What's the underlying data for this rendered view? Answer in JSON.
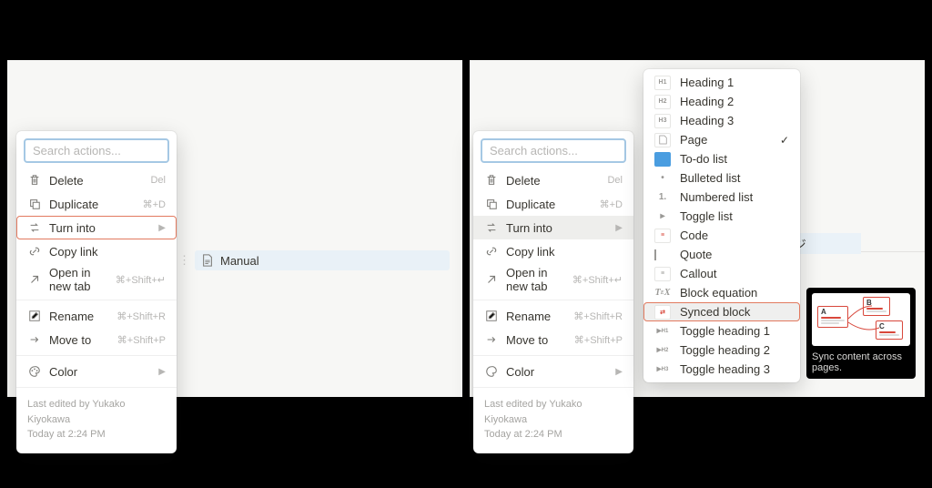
{
  "search_placeholder": "Search actions...",
  "menu": {
    "delete": {
      "label": "Delete",
      "shortcut": "Del"
    },
    "duplicate": {
      "label": "Duplicate",
      "shortcut": "⌘+D"
    },
    "turninto": {
      "label": "Turn into"
    },
    "copylink": {
      "label": "Copy link"
    },
    "opentab": {
      "label": "Open in new tab",
      "shortcut": "⌘+Shift+↵"
    },
    "rename": {
      "label": "Rename",
      "shortcut": "⌘+Shift+R"
    },
    "moveto": {
      "label": "Move to",
      "shortcut": "⌘+Shift+P"
    },
    "color": {
      "label": "Color"
    }
  },
  "footer": {
    "edited_by": "Last edited by Yukako Kiyokawa",
    "timestamp": "Today at 2:24 PM"
  },
  "page_block": {
    "title": "Manual"
  },
  "jp_text": "ージ",
  "submenu": {
    "h1": "Heading 1",
    "h2": "Heading 2",
    "h3": "Heading 3",
    "page": "Page",
    "todo": "To-do list",
    "bulleted": "Bulleted list",
    "numbered": "Numbered list",
    "toggle": "Toggle list",
    "code": "Code",
    "quote": "Quote",
    "callout": "Callout",
    "blockeq": "Block equation",
    "synced": "Synced block",
    "th1": "Toggle heading 1",
    "th2": "Toggle heading 2",
    "th3": "Toggle heading 3"
  },
  "tooltip": "Sync content across pages."
}
